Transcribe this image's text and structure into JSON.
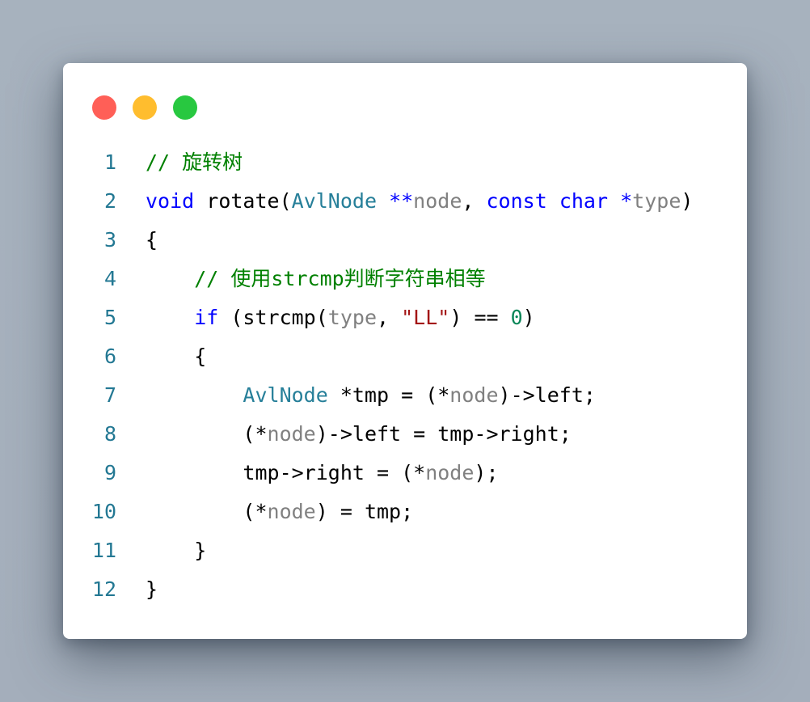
{
  "window": {
    "controls": [
      "close",
      "minimize",
      "maximize"
    ],
    "colors": {
      "close": "#ff5f57",
      "minimize": "#ffbd2e",
      "maximize": "#28c840"
    }
  },
  "code": {
    "language": "c",
    "lines": [
      {
        "number": "1",
        "tokens": [
          {
            "t": "// 旋转树",
            "c": "comment"
          }
        ]
      },
      {
        "number": "2",
        "tokens": [
          {
            "t": "void",
            "c": "keyword"
          },
          {
            "t": " rotate(",
            "c": "plain"
          },
          {
            "t": "AvlNode",
            "c": "type"
          },
          {
            "t": " ",
            "c": "plain"
          },
          {
            "t": "**",
            "c": "keyword"
          },
          {
            "t": "node",
            "c": "param"
          },
          {
            "t": ", ",
            "c": "plain"
          },
          {
            "t": "const",
            "c": "keyword"
          },
          {
            "t": " ",
            "c": "plain"
          },
          {
            "t": "char",
            "c": "keyword"
          },
          {
            "t": " ",
            "c": "plain"
          },
          {
            "t": "*",
            "c": "keyword"
          },
          {
            "t": "type",
            "c": "param"
          },
          {
            "t": ")",
            "c": "plain"
          }
        ]
      },
      {
        "number": "3",
        "tokens": [
          {
            "t": "{",
            "c": "plain"
          }
        ]
      },
      {
        "number": "4",
        "tokens": [
          {
            "t": "    ",
            "c": "plain"
          },
          {
            "t": "// 使用strcmp判断字符串相等",
            "c": "comment"
          }
        ]
      },
      {
        "number": "5",
        "tokens": [
          {
            "t": "    ",
            "c": "plain"
          },
          {
            "t": "if",
            "c": "keyword"
          },
          {
            "t": " (strcmp(",
            "c": "plain"
          },
          {
            "t": "type",
            "c": "param"
          },
          {
            "t": ", ",
            "c": "plain"
          },
          {
            "t": "\"LL\"",
            "c": "string"
          },
          {
            "t": ") == ",
            "c": "plain"
          },
          {
            "t": "0",
            "c": "number"
          },
          {
            "t": ")",
            "c": "plain"
          }
        ]
      },
      {
        "number": "6",
        "tokens": [
          {
            "t": "    {",
            "c": "plain"
          }
        ]
      },
      {
        "number": "7",
        "tokens": [
          {
            "t": "        ",
            "c": "plain"
          },
          {
            "t": "AvlNode",
            "c": "type"
          },
          {
            "t": " *tmp = (*",
            "c": "plain"
          },
          {
            "t": "node",
            "c": "param"
          },
          {
            "t": ")->left;",
            "c": "plain"
          }
        ]
      },
      {
        "number": "8",
        "tokens": [
          {
            "t": "        (*",
            "c": "plain"
          },
          {
            "t": "node",
            "c": "param"
          },
          {
            "t": ")->left = tmp->right;",
            "c": "plain"
          }
        ]
      },
      {
        "number": "9",
        "tokens": [
          {
            "t": "        tmp->right = (*",
            "c": "plain"
          },
          {
            "t": "node",
            "c": "param"
          },
          {
            "t": ");",
            "c": "plain"
          }
        ]
      },
      {
        "number": "10",
        "tokens": [
          {
            "t": "        (*",
            "c": "plain"
          },
          {
            "t": "node",
            "c": "param"
          },
          {
            "t": ") = tmp;",
            "c": "plain"
          }
        ]
      },
      {
        "number": "11",
        "tokens": [
          {
            "t": "    }",
            "c": "plain"
          }
        ]
      },
      {
        "number": "12",
        "tokens": [
          {
            "t": "}",
            "c": "plain"
          }
        ]
      }
    ]
  },
  "syntax_colors": {
    "comment": "#008000",
    "keyword": "#0000ff",
    "type": "#267f99",
    "param": "#808080",
    "string": "#a31515",
    "number": "#098658",
    "plain": "#000000",
    "line_number": "#237893"
  }
}
